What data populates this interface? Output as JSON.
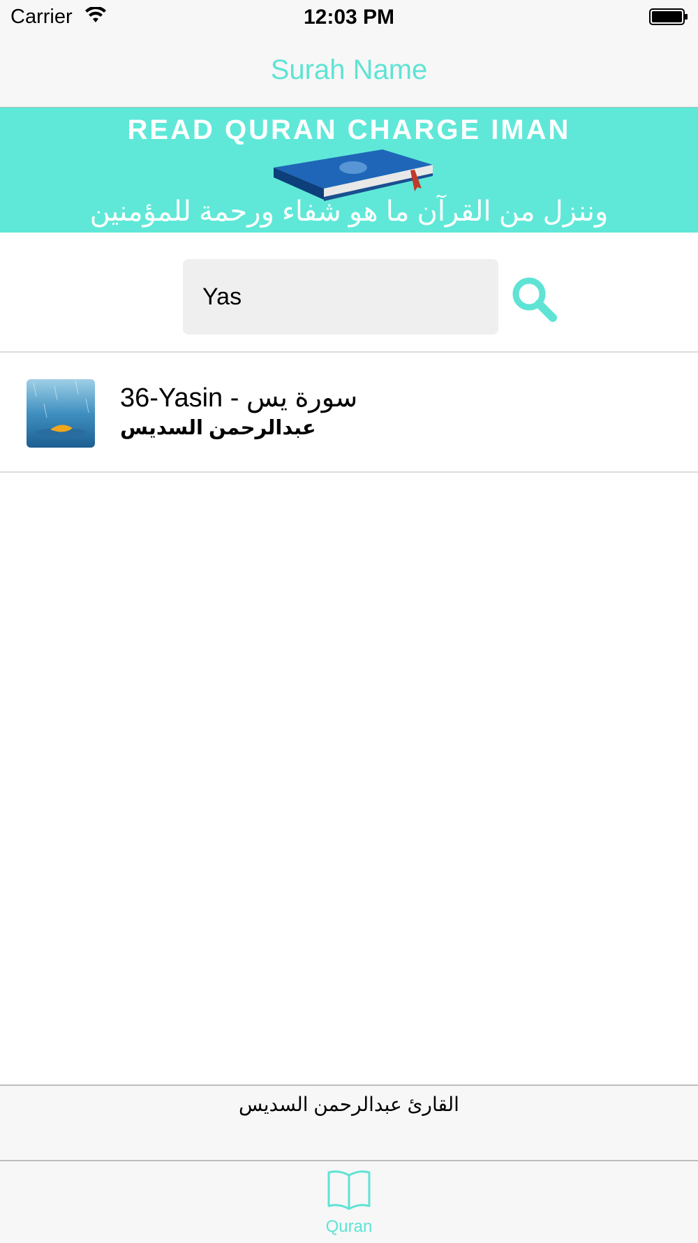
{
  "status_bar": {
    "carrier": "Carrier",
    "time": "12:03 PM",
    "icons": [
      "wifi-icon",
      "battery-icon"
    ]
  },
  "nav": {
    "title": "Surah Name",
    "accent_color": "#5fe3d4"
  },
  "banner": {
    "title": "READ QURAN CHARGE IMAN",
    "arabic_text": "وننزل من القرآن ما هو شفاء ورحمة للمؤمنين",
    "background_color": "#5fe8d8",
    "image": "quran-book-image"
  },
  "search": {
    "value": "Yas",
    "placeholder": "",
    "button_icon": "search-icon"
  },
  "results": [
    {
      "title_latin": "36-Yasin - ",
      "title_arabic": "سورة يس",
      "subtitle": "عبدالرحمن السديس",
      "thumbnail": "rain-leaf-thumbnail"
    }
  ],
  "player": {
    "text": "القارئ عبدالرحمن السديس"
  },
  "tab_bar": {
    "tabs": [
      {
        "label": "Quran",
        "icon": "book-icon",
        "selected": true
      }
    ]
  }
}
